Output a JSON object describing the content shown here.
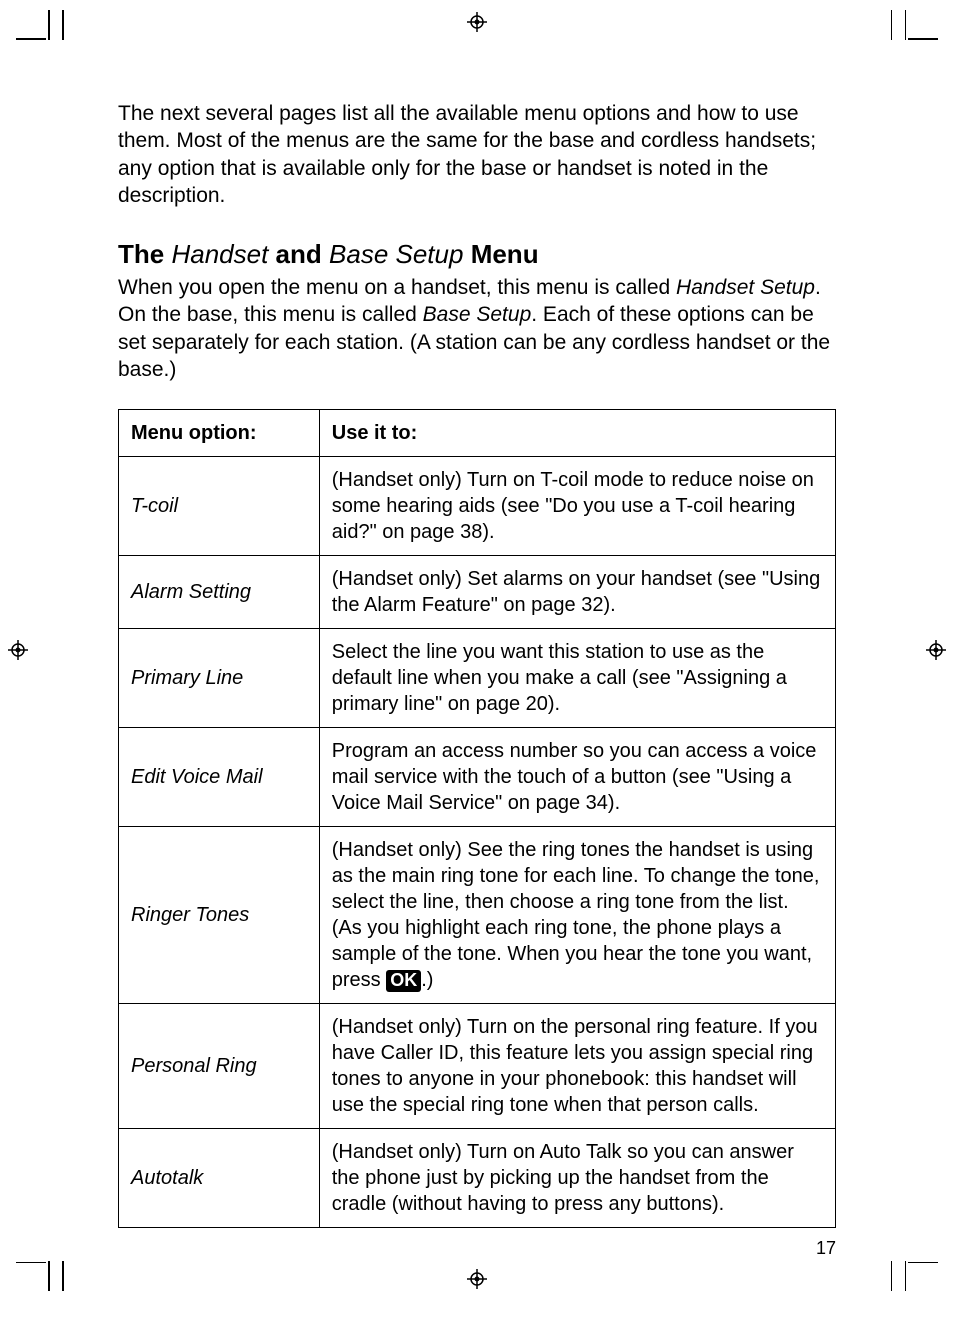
{
  "intro": "The next several pages list all the available menu options and how to use them. Most of the menus are the same for the base and cordless handsets; any option that is available only for the base or handset is noted in the description.",
  "heading": {
    "pre": "The",
    "ital1": "Handset",
    "mid": "and",
    "ital2": "Base Setup",
    "post": "Menu"
  },
  "sub": {
    "part1": "When you open the menu on a handset, this menu is called ",
    "ital1": "Handset Setup",
    "part2": ". On the base, this menu is called ",
    "ital2": "Base Setup",
    "part3": ". Each of these options can be set separately for each station. (A station can be any cordless handset or the base.)"
  },
  "table": {
    "header_col1": "Menu option:",
    "header_col2": "Use it to:",
    "rows": [
      {
        "option": "T-coil",
        "use": "(Handset only) Turn on T-coil mode to reduce noise on some hearing aids (see \"Do you use a T-coil hearing aid?\" on page 38)."
      },
      {
        "option": "Alarm Setting",
        "use": "(Handset only) Set alarms on your handset (see \"Using the Alarm Feature\" on page 32)."
      },
      {
        "option": "Primary Line",
        "use": "Select the line you want this station to use as the default line when you make a call (see \"Assigning a primary line\" on page 20)."
      },
      {
        "option": "Edit Voice Mail",
        "use": "Program an access number so you can access a voice mail service with the touch of a button (see \"Using a Voice Mail Service\" on page 34)."
      },
      {
        "option": "Ringer Tones",
        "use_pre": "(Handset only) See the ring tones the handset is using as the main ring tone for each line. To change the tone, select the line, then choose a ring tone from the list. (As you highlight each ring tone, the phone plays a sample of the tone. When you hear the tone you want, press ",
        "ok": "OK",
        "use_post": ".)"
      },
      {
        "option": "Personal Ring",
        "use": "(Handset only) Turn on the personal ring feature. If you have Caller ID, this feature lets you assign special ring tones to anyone in your phonebook: this handset will use the special ring tone when that person calls."
      },
      {
        "option": "Autotalk",
        "use": "(Handset only) Turn on Auto Talk so you can answer the phone just by picking up the handset from the cradle (without having to press any buttons)."
      }
    ]
  },
  "page_number": "17"
}
